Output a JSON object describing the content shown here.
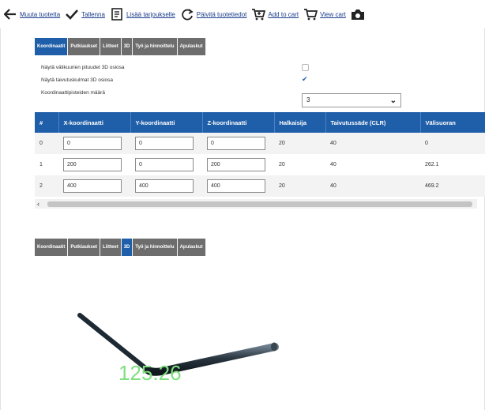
{
  "toolbar": {
    "items": [
      {
        "icon": "back-arrow-icon",
        "label": "Muuta tuotetta"
      },
      {
        "icon": "checkmark-icon",
        "label": "Tallenna"
      },
      {
        "icon": "document-icon",
        "label": "Lisää tarjoukselle"
      },
      {
        "icon": "refresh-icon",
        "label": "Päivitä tuotetiedot"
      },
      {
        "icon": "add-to-cart-icon",
        "label": "Add to cart"
      },
      {
        "icon": "cart-icon",
        "label": "View cart"
      },
      {
        "icon": "camera-icon",
        "label": ""
      }
    ]
  },
  "tabs_top": {
    "items": [
      "Koordinaatit",
      "Putkiaukset",
      "Liitteet",
      "3D",
      "Työ ja hinnoittelu",
      "Apulaskut"
    ],
    "active_index": 0
  },
  "settings": {
    "show_curve_3d_label": "Näytä välikuurien pituudet 3D osiosa",
    "show_curve_3d_checked": false,
    "show_bend_angles_label": "Näytä taivutuskulmat 3D osiosa",
    "show_bend_angles_checked": true,
    "point_count_label": "Koordinaattipisteiden määrä",
    "point_count_value": "3"
  },
  "table": {
    "headers": [
      "#",
      "X-koordinaatti",
      "Y-koordinaatti",
      "Z-koordinaatti",
      "Halkaisija",
      "Taivutussäde (CLR)",
      "Välisuoran"
    ],
    "rows": [
      {
        "index": "0",
        "x": "0",
        "y": "0",
        "z": "0",
        "diameter": "20",
        "radius": "40",
        "straight": "0"
      },
      {
        "index": "1",
        "x": "200",
        "y": "0",
        "z": "200",
        "diameter": "20",
        "radius": "40",
        "straight": "262.1"
      },
      {
        "index": "2",
        "x": "400",
        "y": "400",
        "z": "400",
        "diameter": "20",
        "radius": "40",
        "straight": "469.2"
      }
    ]
  },
  "scrollbar": {
    "left_arrow": "‹"
  },
  "tabs_bottom": {
    "items": [
      "Koordinaatit",
      "Putkiaukset",
      "Liitteet",
      "3D",
      "Työ ja hinnoittelu",
      "Apulaskut"
    ],
    "active_index": 3
  },
  "viewer": {
    "angle_label": "125.26",
    "angle_color": "#7fe07f",
    "pipe_color": "#1e2a33",
    "accent_color": "#1f5ea8"
  }
}
